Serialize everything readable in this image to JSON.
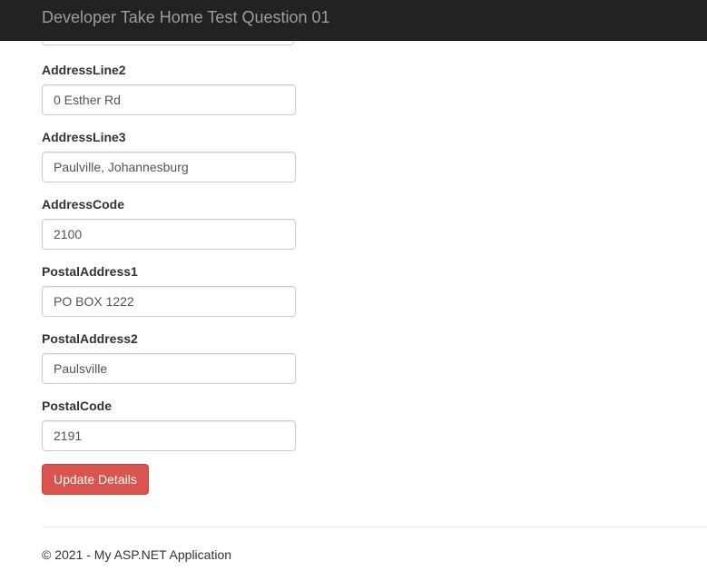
{
  "navbar": {
    "brand": "Developer Take Home Test Question 01"
  },
  "form": {
    "fields": [
      {
        "label": "AddressLine2",
        "value": "0 Esther Rd"
      },
      {
        "label": "AddressLine3",
        "value": "Paulville, Johannesburg"
      },
      {
        "label": "AddressCode",
        "value": "2100"
      },
      {
        "label": "PostalAddress1",
        "value": "PO BOX 1222"
      },
      {
        "label": "PostalAddress2",
        "value": "Paulsville"
      },
      {
        "label": "PostalCode",
        "value": "2191"
      }
    ],
    "submit_label": "Update Details"
  },
  "footer": {
    "text": "© 2021 - My ASP.NET Application"
  },
  "colors": {
    "navbar_bg": "#222222",
    "brand_text": "#9d9d9d",
    "danger_button": "#d9534f"
  }
}
